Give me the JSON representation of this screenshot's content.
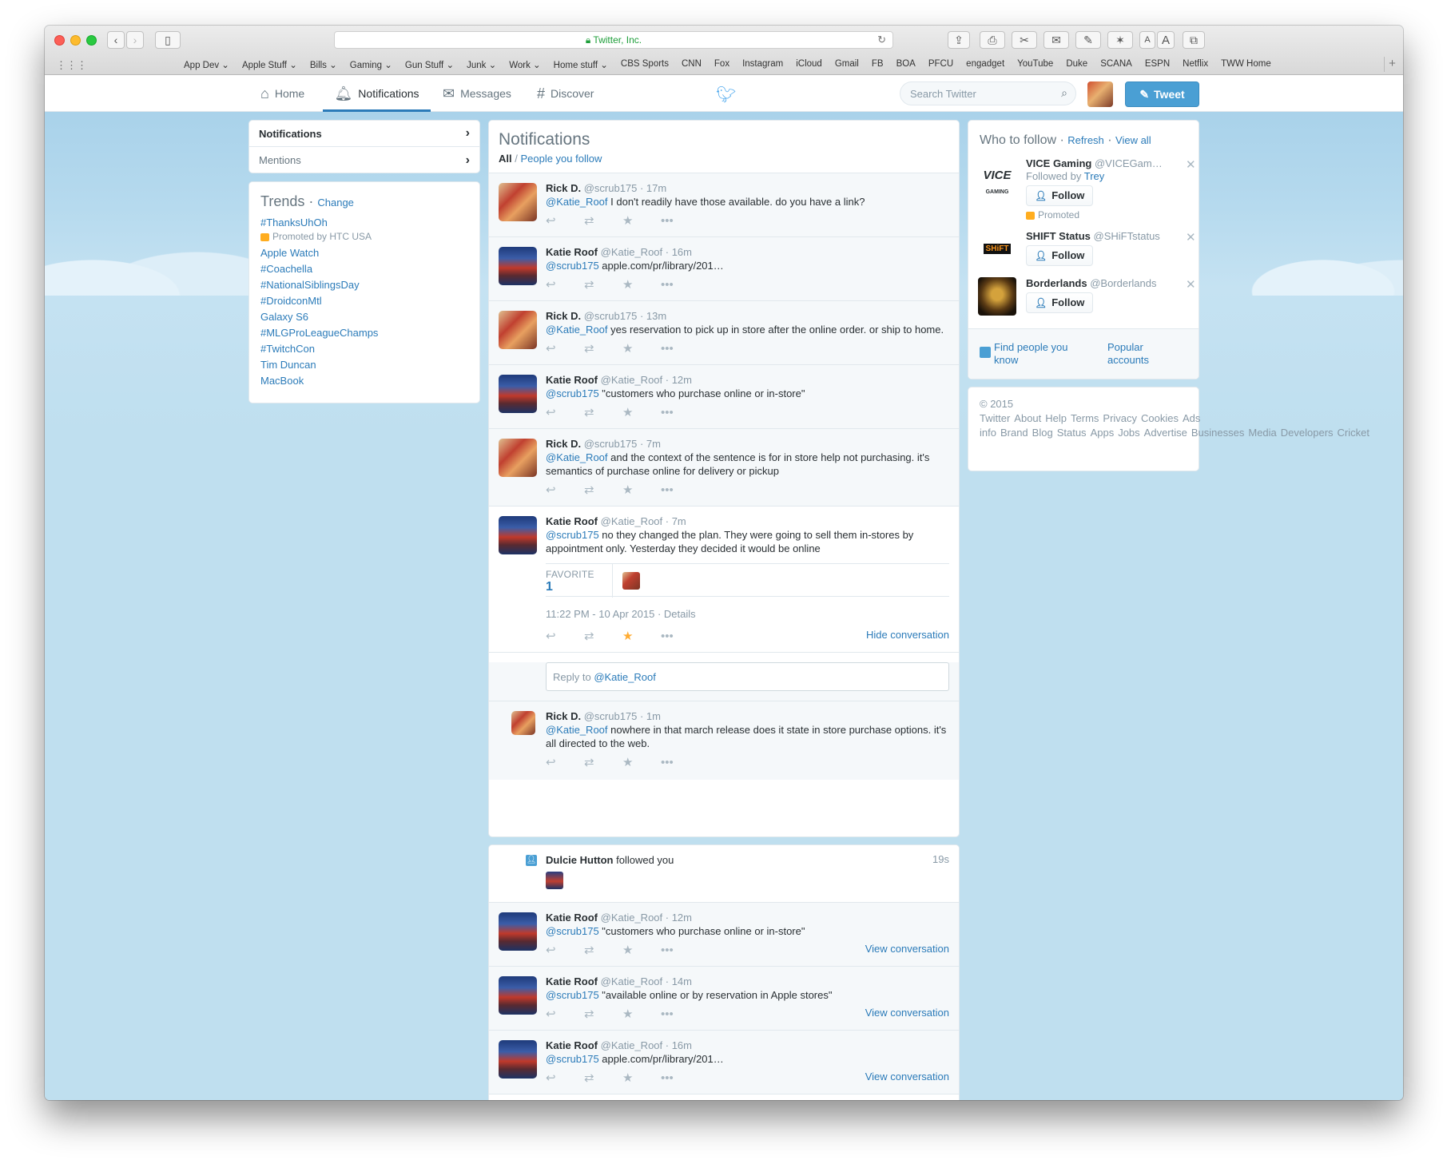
{
  "browser": {
    "url": "Twitter, Inc.",
    "bookmarks": [
      "App Dev ⌄",
      "Apple Stuff ⌄",
      "Bills ⌄",
      "Gaming ⌄",
      "Gun Stuff ⌄",
      "Junk ⌄",
      "Work ⌄",
      "Home stuff ⌄",
      "CBS Sports",
      "CNN",
      "Fox",
      "Instagram",
      "iCloud",
      "Gmail",
      "FB",
      "BOA",
      "PFCU",
      "engadget",
      "YouTube",
      "Duke",
      "SCANA",
      "ESPN",
      "Netflix",
      "TWW Home"
    ]
  },
  "nav": {
    "home": "Home",
    "notifications": "Notifications",
    "messages": "Messages",
    "discover": "Discover",
    "search_placeholder": "Search Twitter",
    "tweet": "Tweet"
  },
  "left": {
    "notifications": "Notifications",
    "mentions": "Mentions",
    "trends_title": "Trends",
    "change": "Change",
    "promoted": "Promoted by HTC USA",
    "trends": [
      "#ThanksUhOh",
      "Apple Watch",
      "#Coachella",
      "#NationalSiblingsDay",
      "#DroidconMtl",
      "Galaxy S6",
      "#MLGProLeagueChamps",
      "#TwitchCon",
      "Tim Duncan",
      "MacBook"
    ]
  },
  "stream": {
    "title": "Notifications",
    "filter_all": "All",
    "filter_sep": " / ",
    "filter_follow": "People you follow",
    "tweets": [
      {
        "name": "Rick D.",
        "handle": "@scrub175 · 17m",
        "mention": "@Katie_Roof",
        "text": " I don't readily have those available. do you have a link?"
      },
      {
        "name": "Katie Roof",
        "handle": "@Katie_Roof · 16m",
        "mention": "@scrub175",
        "text": " apple.com/pr/library/201…"
      },
      {
        "name": "Rick D.",
        "handle": "@scrub175 · 13m",
        "mention": "@Katie_Roof",
        "text": " yes reservation to pick up in store after the online order. or ship to home."
      },
      {
        "name": "Katie Roof",
        "handle": "@Katie_Roof · 12m",
        "mention": "@scrub175",
        "text": " \"customers who purchase online or in-store\""
      },
      {
        "name": "Rick D.",
        "handle": "@scrub175 · 7m",
        "mention": "@Katie_Roof",
        "text": " and the context of the sentence is for in store help not purchasing. it's semantics of purchase online for delivery or pickup"
      },
      {
        "name": "Katie Roof",
        "handle": "@Katie_Roof · 7m",
        "mention": "@scrub175",
        "text": " no they changed the plan. They were going to sell them in-stores by appointment only. Yesterday they decided it would be online"
      }
    ],
    "favorite_label": "FAVORITE",
    "favorite_count": "1",
    "timestamp": "11:22 PM - 10 Apr 2015 · Details",
    "hide_convo": "Hide conversation",
    "reply_prefix": "Reply to ",
    "reply_handle": "@Katie_Roof",
    "reply_tweet": {
      "name": "Rick D.",
      "handle": "@scrub175 · 1m",
      "mention": "@Katie_Roof",
      "text": " nowhere in that march release does it state in store purchase options. it's all directed to the web."
    },
    "follow_notice": {
      "name": "Dulcie Hutton",
      "text": " followed you",
      "time": "19s"
    },
    "mentions": [
      {
        "name": "Katie Roof",
        "handle": "@Katie_Roof · 12m",
        "mention": "@scrub175",
        "text": " \"customers who purchase online or in-store\""
      },
      {
        "name": "Katie Roof",
        "handle": "@Katie_Roof · 14m",
        "mention": "@scrub175",
        "text": " \"available online or by reservation in Apple stores\""
      },
      {
        "name": "Katie Roof",
        "handle": "@Katie_Roof · 16m",
        "mention": "@scrub175",
        "text": " apple.com/pr/library/201…"
      }
    ],
    "view_convo": "View conversation"
  },
  "wtf": {
    "title": "Who to follow",
    "refresh": "Refresh",
    "view_all": "View all",
    "follow": "Follow",
    "promoted": "Promoted",
    "accounts": [
      {
        "name": "VICE Gaming",
        "handle": "@VICEGam…",
        "sub_prefix": "Followed by ",
        "sub_link": "Trey"
      },
      {
        "name": "SHIFT Status",
        "handle": "@SHiFTstatus"
      },
      {
        "name": "Borderlands",
        "handle": "@Borderlands"
      }
    ],
    "find_people": "Find people you know",
    "popular": "Popular accounts",
    "vice_logo": "VICE",
    "vice_sub": "GAMING",
    "shift_logo": "SHiFT"
  },
  "footer": [
    "© 2015 Twitter",
    "About",
    "Help",
    "Terms",
    "Privacy",
    "Cookies",
    "Ads info",
    "Brand",
    "Blog",
    "Status",
    "Apps",
    "Jobs",
    "Advertise",
    "Businesses",
    "Media",
    "Developers",
    "Cricket"
  ]
}
